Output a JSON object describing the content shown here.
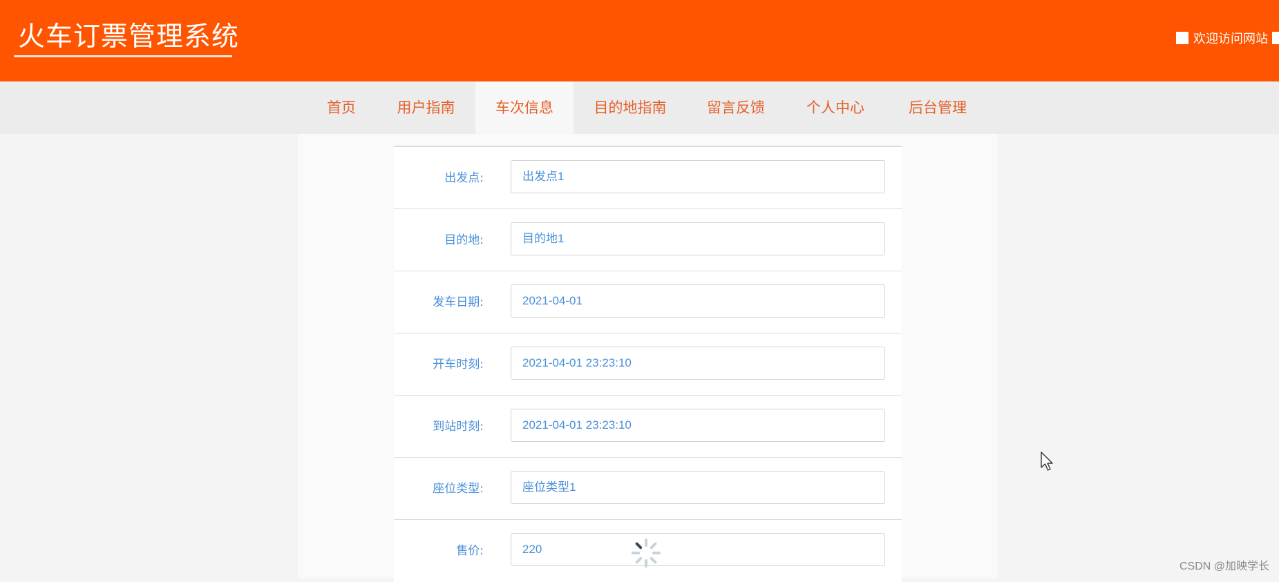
{
  "header": {
    "site_title": "火车订票管理系统",
    "welcome_text": "欢迎访问网站"
  },
  "nav": {
    "items": [
      {
        "label": "首页",
        "active": false
      },
      {
        "label": "用户指南",
        "active": false
      },
      {
        "label": "车次信息",
        "active": true
      },
      {
        "label": "目的地指南",
        "active": false
      },
      {
        "label": "留言反馈",
        "active": false
      },
      {
        "label": "个人中心",
        "active": false
      },
      {
        "label": "后台管理",
        "active": false
      }
    ]
  },
  "form": {
    "fields": [
      {
        "label": "出发点:",
        "value": "出发点1"
      },
      {
        "label": "目的地:",
        "value": "目的地1"
      },
      {
        "label": "发车日期:",
        "value": "2021-04-01"
      },
      {
        "label": "开车时刻:",
        "value": "2021-04-01 23:23:10"
      },
      {
        "label": "到站时刻:",
        "value": "2021-04-01 23:23:10"
      },
      {
        "label": "座位类型:",
        "value": "座位类型1"
      },
      {
        "label": "售价:",
        "value": "220"
      }
    ]
  },
  "watermark": "CSDN @加映学长",
  "colors": {
    "brand": "#ff5500",
    "nav_text": "#e4612a",
    "field_text": "#4a90d9"
  }
}
